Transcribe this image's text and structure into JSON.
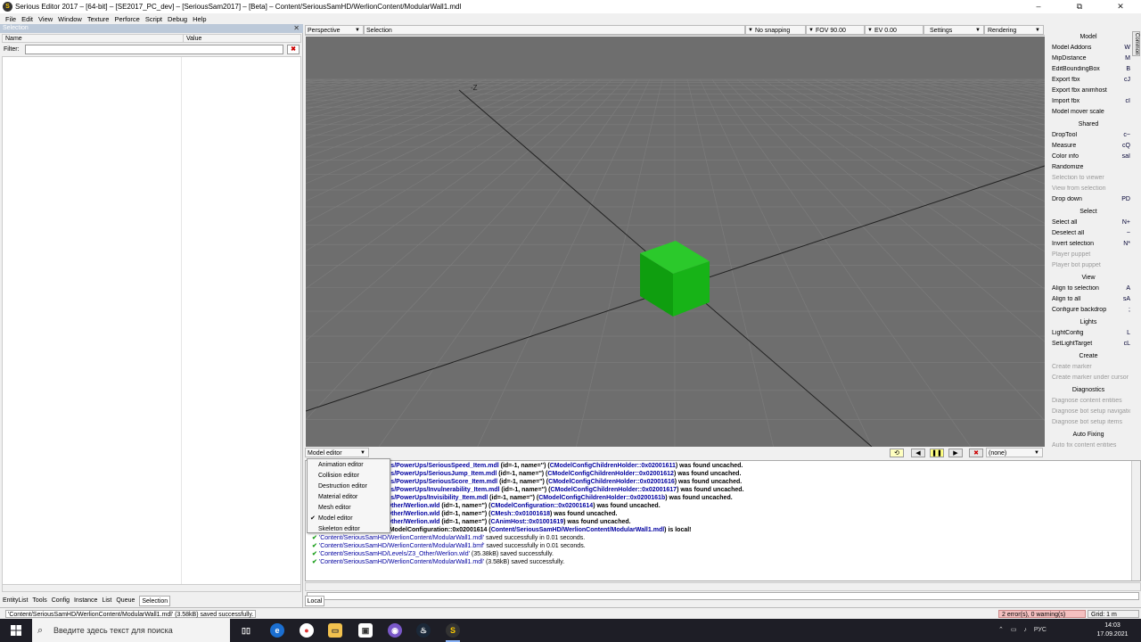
{
  "window": {
    "title": "Serious Editor 2017 – [64-bit] – [SE2017_PC_dev] – [SeriousSam2017] – [Beta] – Content/SeriousSamHD/WerlionContent/ModularWall1.mdl",
    "minimize": "–",
    "maximize": "⧉",
    "close": "✕"
  },
  "menubar": [
    "File",
    "Edit",
    "View",
    "Window",
    "Texture",
    "Perforce",
    "Script",
    "Debug",
    "Help"
  ],
  "leftpanel": {
    "header": "Selection",
    "close": "✕",
    "col_name": "Name",
    "col_value": "Value",
    "filter_label": "Filter:",
    "filter_value": "",
    "filter_clear": "✖",
    "tabs": [
      "EntityList",
      "Tools",
      "Config",
      "Instance",
      "List",
      "Queue",
      "Selection"
    ]
  },
  "viewport": {
    "toolbar": {
      "view_mode": "Perspective",
      "tool": "Selection",
      "snapping": "No snapping",
      "fov": "FOV 90.00",
      "ev": "EV  0.00",
      "settings": "Settings",
      "rendering": "Rendering"
    },
    "axis_label": "-Z",
    "editor_select": "Model editor",
    "anim_select": "(none)"
  },
  "editor_menu": {
    "items": [
      "Animation editor",
      "Collision editor",
      "Destruction editor",
      "Material editor",
      "Mesh editor",
      "Model editor",
      "Skeleton editor"
    ],
    "checked": "Model editor",
    "check_mark": "✔"
  },
  "rightpanel": {
    "side_tab": "Common",
    "sections": [
      {
        "title": "Model",
        "items": [
          {
            "label": "Model Addons",
            "key": "W",
            "disabled": false
          },
          {
            "label": "MipDistance",
            "key": "M",
            "disabled": false
          },
          {
            "label": "EditBoundingBox",
            "key": "B",
            "disabled": false
          },
          {
            "label": "Export fbx",
            "key": "cJ",
            "disabled": false
          },
          {
            "label": "Export fbx animhost",
            "key": "",
            "disabled": false
          },
          {
            "label": "Import fbx",
            "key": "cI",
            "disabled": false
          },
          {
            "label": "Model mover scale",
            "key": "",
            "disabled": false
          }
        ]
      },
      {
        "title": "Shared",
        "items": [
          {
            "label": "DropTool",
            "key": "c~",
            "disabled": false
          },
          {
            "label": "Measure",
            "key": "cQ",
            "disabled": false
          },
          {
            "label": "Color info",
            "key": "saI",
            "disabled": false
          },
          {
            "label": "Randomize",
            "key": "",
            "disabled": false
          },
          {
            "label": "Selection to viewer",
            "key": "",
            "disabled": true
          },
          {
            "label": "View from selection",
            "key": "",
            "disabled": true
          },
          {
            "label": "Drop down",
            "key": "PD",
            "disabled": false
          }
        ]
      },
      {
        "title": "Select",
        "items": [
          {
            "label": "Select all",
            "key": "N+",
            "disabled": false
          },
          {
            "label": "Deselect all",
            "key": "~",
            "disabled": false
          },
          {
            "label": "Invert selection",
            "key": "N*",
            "disabled": false
          },
          {
            "label": "Player puppet",
            "key": "",
            "disabled": true
          },
          {
            "label": "Player bot puppet",
            "key": "",
            "disabled": true
          }
        ]
      },
      {
        "title": "View",
        "items": [
          {
            "label": "Align to selection",
            "key": "A",
            "disabled": false
          },
          {
            "label": "Align to all",
            "key": "sA",
            "disabled": false
          },
          {
            "label": "Configure backdrop",
            "key": ";",
            "disabled": false
          }
        ]
      },
      {
        "title": "Lights",
        "items": [
          {
            "label": "LightConfig",
            "key": "L",
            "disabled": false
          },
          {
            "label": "SetLightTarget",
            "key": "cL",
            "disabled": false
          }
        ]
      },
      {
        "title": "Create",
        "items": [
          {
            "label": "Create marker",
            "key": "",
            "disabled": true
          },
          {
            "label": "Create marker under cursor",
            "key": "",
            "disabled": true
          }
        ]
      },
      {
        "title": "Diagnostics",
        "items": [
          {
            "label": "Diagnose content entities",
            "key": "",
            "disabled": true
          },
          {
            "label": "Diagnose bot setup navigation",
            "key": "",
            "disabled": true
          },
          {
            "label": "Diagnose bot setup items",
            "key": "",
            "disabled": true
          }
        ]
      },
      {
        "title": "Auto Fixing",
        "items": [
          {
            "label": "Auto fix content entities",
            "key": "",
            "disabled": true
          }
        ]
      }
    ]
  },
  "log": {
    "lines": [
      {
        "ok": false,
        "pre": "",
        "path": "eriousSamHD/Models/Items/PowerUps/SeriousSpeed_Item.mdl",
        "mid": " (id=-1, name='') (",
        "obj": "CModelConfigChildrenHolder::0x02001611",
        "post": ") was found uncached."
      },
      {
        "ok": false,
        "pre": "",
        "path": "eriousSamHD/Models/Items/PowerUps/SeriousJump_Item.mdl",
        "mid": " (id=-1, name='') (",
        "obj": "CModelConfigChildrenHolder::0x02001612",
        "post": ") was found uncached."
      },
      {
        "ok": false,
        "pre": "",
        "path": "eriousSamHD/Models/Items/PowerUps/SeriousScore_Item.mdl",
        "mid": " (id=-1, name='') (",
        "obj": "CModelConfigChildrenHolder::0x02001616",
        "post": ") was found uncached."
      },
      {
        "ok": false,
        "pre": "",
        "path": "eriousSamHD/Models/Items/PowerUps/Invulnerability_Item.mdl",
        "mid": " (id=-1, name='') (",
        "obj": "CModelConfigChildrenHolder::0x02001617",
        "post": ") was found uncached."
      },
      {
        "ok": false,
        "pre": "",
        "path": "eriousSamHD/Models/Items/PowerUps/Invisibility_Item.mdl",
        "mid": " (id=-1, name='') (",
        "obj": "CModelConfigChildrenHolder::0x0200161b",
        "post": ") was found uncached."
      },
      {
        "ok": false,
        "pre": "",
        "path": "eriousSamHD/Levels/Z3_Other/Werlion.wld",
        "mid": " (id=-1, name='') (",
        "obj": "CModelConfiguration::0x02001614",
        "post": ") was found uncached."
      },
      {
        "ok": false,
        "pre": "",
        "path": "eriousSamHD/Levels/Z3_Other/Werlion.wld",
        "mid": " (id=-1, name='') (",
        "obj": "CMesh::0x01001618",
        "post": ") was found uncached."
      },
      {
        "ok": false,
        "pre": "",
        "path": "eriousSamHD/Levels/Z3_Other/Werlion.wld",
        "mid": " (id=-1, name='') (",
        "obj": "CAnimHost::0x01001619",
        "post": ") was found uncached."
      },
      {
        "ok": false,
        "pre": "Mesh obtained in model CModelConfiguration::0x02001614 (",
        "path": "Content/SeriousSamHD/WerlionContent/ModularWall1.mdl",
        "mid": "",
        "obj": "",
        "post": ") is local!"
      },
      {
        "ok": true,
        "pre": "",
        "path": "'Content/SeriousSamHD/WerlionContent/ModularWall1.mdl'",
        "mid": "",
        "obj": "",
        "post": " saved successfully in 0.01 seconds."
      },
      {
        "ok": true,
        "pre": "",
        "path": "'Content/SeriousSamHD/WerlionContent/ModularWall1.bmf'",
        "mid": "",
        "obj": "",
        "post": " saved successfully in 0.01 seconds."
      },
      {
        "ok": true,
        "pre": "",
        "path": "'Content/SeriousSamHD/Levels/Z3_Other/Werlion.wld'",
        "mid": "",
        "obj": "",
        "post": " (35.38kB) saved successfully."
      },
      {
        "ok": true,
        "pre": "",
        "path": "'Content/SeriousSamHD/WerlionContent/ModularWall1.mdl'",
        "mid": "",
        "obj": "",
        "post": " (3.58kB) saved successfully."
      }
    ],
    "tab_local": "Local"
  },
  "status": {
    "message": "'Content/SeriousSamHD/WerlionContent/ModularWall1.mdl' (3.58kB) saved successfully.",
    "errors": "2 error(s), 0 warning(s)",
    "grid": "Grid: 1 m"
  },
  "taskbar": {
    "search_placeholder": "Введите здесь текст для поиска",
    "lang": "РУС",
    "time": "14:03",
    "date": "17.09.2021"
  },
  "colors": {
    "cube": "#1aa81a",
    "viewport_bg": "#6e6e6e",
    "grid": "#7a7a7a"
  }
}
